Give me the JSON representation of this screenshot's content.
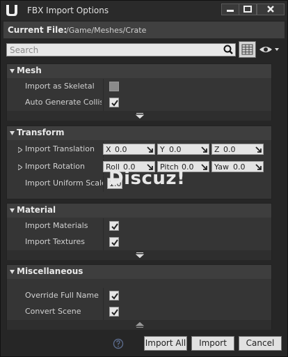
{
  "window": {
    "title": "FBX Import Options"
  },
  "file": {
    "label": "Current File:",
    "path": "/Game/Meshes/Crate"
  },
  "search": {
    "placeholder": "Search"
  },
  "categories": {
    "mesh": {
      "title": "Mesh",
      "rows": [
        {
          "label": "Import as Skeletal",
          "checked": false
        },
        {
          "label": "Auto Generate Collisi",
          "checked": true
        }
      ]
    },
    "transform": {
      "title": "Transform",
      "translation": {
        "label": "Import Translation",
        "x_label": "X",
        "x": "0.0",
        "y_label": "Y",
        "y": "0.0",
        "z_label": "Z",
        "z": "0.0"
      },
      "rotation": {
        "label": "Import Rotation",
        "roll_label": "Roll",
        "roll": "0.0",
        "pitch_label": "Pitch",
        "pitch": "0.0",
        "yaw_label": "Yaw",
        "yaw": "0.0"
      },
      "scale": {
        "label": "Import Uniform Scale",
        "value": "1.0"
      }
    },
    "material": {
      "title": "Material",
      "rows": [
        {
          "label": "Import Materials",
          "checked": true
        },
        {
          "label": "Import Textures",
          "checked": true
        }
      ]
    },
    "misc": {
      "title": "Miscellaneous",
      "rows": [
        {
          "label": "Override Full Name",
          "checked": true
        },
        {
          "label": "Convert Scene",
          "checked": true
        }
      ]
    }
  },
  "watermark": "Discuz!",
  "buttons": {
    "import_all": "Import All",
    "import": "Import",
    "cancel": "Cancel"
  }
}
